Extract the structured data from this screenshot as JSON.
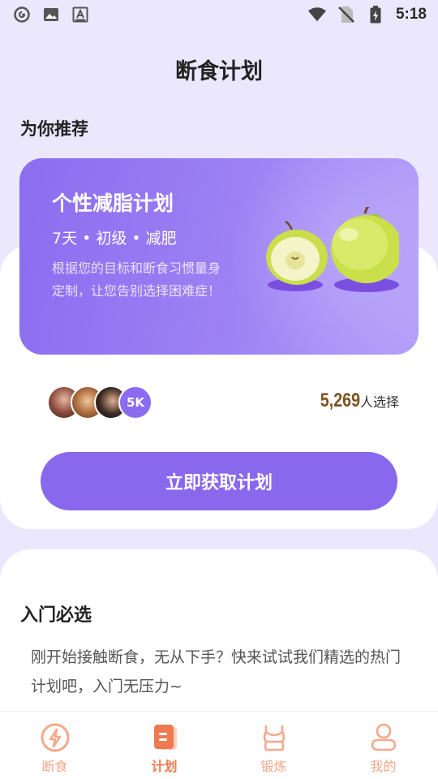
{
  "status_bar": {
    "time": "5:18",
    "left_icons": [
      "circle-g-icon",
      "image-icon",
      "a-box-icon"
    ],
    "right_icons": [
      "wifi-icon",
      "no-sim-icon",
      "battery-icon"
    ]
  },
  "header": {
    "title": "断食计划"
  },
  "recommend": {
    "section_title": "为你推荐",
    "card": {
      "title": "个性减脂计划",
      "tags": "7天 • 初级 • 减肥",
      "description": "根据您的目标和断食习惯量身定制，让您告别选择困难症！",
      "illustration": "green-apples-icon"
    },
    "avatars_badge": "5K",
    "choose_number": "5,269",
    "choose_label": "人选择",
    "cta_label": "立即获取计划"
  },
  "entry": {
    "section_title": "入门必选",
    "description": "刚开始接触断食，无从下手？快来试试我们精选的热门计划吧，入门无压力~"
  },
  "tab_bar": {
    "items": [
      {
        "label": "断食",
        "icon": "lightning-icon"
      },
      {
        "label": "计划",
        "icon": "plan-doc-icon"
      },
      {
        "label": "锻炼",
        "icon": "sports-top-icon"
      },
      {
        "label": "我的",
        "icon": "profile-icon"
      }
    ],
    "active_index": 1
  },
  "colors": {
    "background": "#ebe7fd",
    "accent": "#8a68ee",
    "tab_active": "#f07a50",
    "tab_inactive": "#f5a88a",
    "count_number": "#7a5420"
  }
}
